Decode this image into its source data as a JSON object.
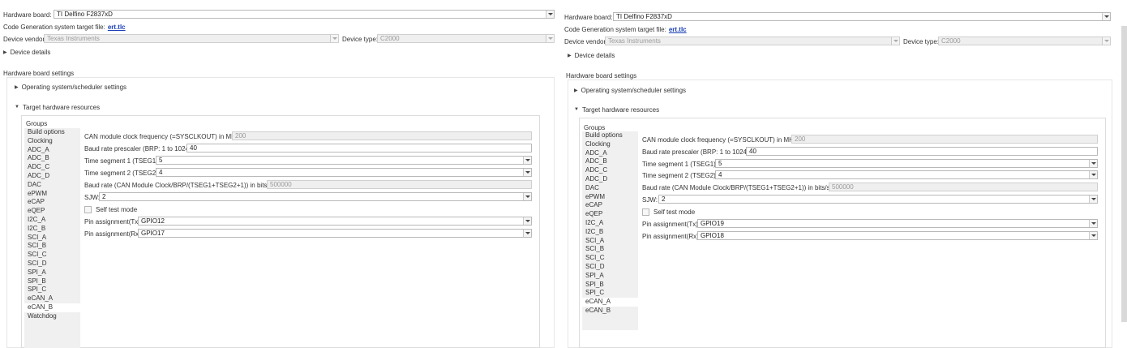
{
  "left": {
    "hardware_board_label": "Hardware board:",
    "hardware_board_value": "TI Delfino F2837xD",
    "codegen_label": "Code Generation system target file:",
    "codegen_link": "ert.tlc",
    "device_vendor_label": "Device vendor:",
    "device_vendor_value": "Texas Instruments",
    "device_type_label": "Device type:",
    "device_type_value": "C2000",
    "device_details": "Device details",
    "hw_settings_title": "Hardware board settings",
    "os_settings": "Operating system/scheduler settings",
    "target_resources": "Target hardware resources",
    "groups_title": "Groups",
    "groups": [
      "Build options",
      "Clocking",
      "ADC_A",
      "ADC_B",
      "ADC_C",
      "ADC_D",
      "DAC",
      "ePWM",
      "eCAP",
      "eQEP",
      "I2C_A",
      "I2C_B",
      "SCI_A",
      "SCI_B",
      "SCI_C",
      "SCI_D",
      "SPI_A",
      "SPI_B",
      "SPI_C",
      "eCAN_A",
      "eCAN_B",
      "Watchdog"
    ],
    "selected_group": "eCAN_B",
    "can_clock_label": "CAN module clock frequency (=SYSCLKOUT) in MHz:",
    "can_clock_value": "200",
    "brp_label": "Baud rate prescaler (BRP: 1 to 1024):",
    "brp_value": "40",
    "tseg1_label": "Time segment 1 (TSEG1):",
    "tseg1_value": "5",
    "tseg2_label": "Time segment 2 (TSEG2):",
    "tseg2_value": "4",
    "baud_label": "Baud rate (CAN Module Clock/BRP/(TSEG1+TSEG2+1)) in bits/sec:",
    "baud_value": "500000",
    "sjw_label": "SJW:",
    "sjw_value": "2",
    "self_test_label": "Self test mode",
    "tx_label": "Pin assignment(Tx):",
    "tx_value": "GPIO12",
    "rx_label": "Pin assignment(Rx):",
    "rx_value": "GPIO17"
  },
  "right": {
    "hardware_board_label": "Hardware board:",
    "hardware_board_value": "TI Delfino F2837xD",
    "codegen_label": "Code Generation system target file:",
    "codegen_link": "ert.tlc",
    "device_vendor_label": "Device vendor:",
    "device_vendor_value": "Texas Instruments",
    "device_type_label": "Device type:",
    "device_type_value": "C2000",
    "device_details": "Device details",
    "hw_settings_title": "Hardware board settings",
    "os_settings": "Operating system/scheduler settings",
    "target_resources": "Target hardware resources",
    "groups_title": "Groups",
    "groups": [
      "Build options",
      "Clocking",
      "ADC_A",
      "ADC_B",
      "ADC_C",
      "ADC_D",
      "DAC",
      "ePWM",
      "eCAP",
      "eQEP",
      "I2C_A",
      "I2C_B",
      "SCI_A",
      "SCI_B",
      "SCI_C",
      "SCI_D",
      "SPI_A",
      "SPI_B",
      "SPI_C",
      "eCAN_A",
      "eCAN_B"
    ],
    "selected_group": "eCAN_A",
    "can_clock_label": "CAN module clock frequency (=SYSCLKOUT) in MHz:",
    "can_clock_value": "200",
    "brp_label": "Baud rate prescaler (BRP: 1 to 1024):",
    "brp_value": "40",
    "tseg1_label": "Time segment 1 (TSEG1):",
    "tseg1_value": "5",
    "tseg2_label": "Time segment 2 (TSEG2):",
    "tseg2_value": "4",
    "baud_label": "Baud rate (CAN Module Clock/BRP/(TSEG1+TSEG2+1)) in bits/sec:",
    "baud_value": "500000",
    "sjw_label": "SJW:",
    "sjw_value": "2",
    "self_test_label": "Self test mode",
    "tx_label": "Pin assignment(Tx):",
    "tx_value": "GPIO19",
    "rx_label": "Pin assignment(Rx):",
    "rx_value": "GPIO18"
  }
}
